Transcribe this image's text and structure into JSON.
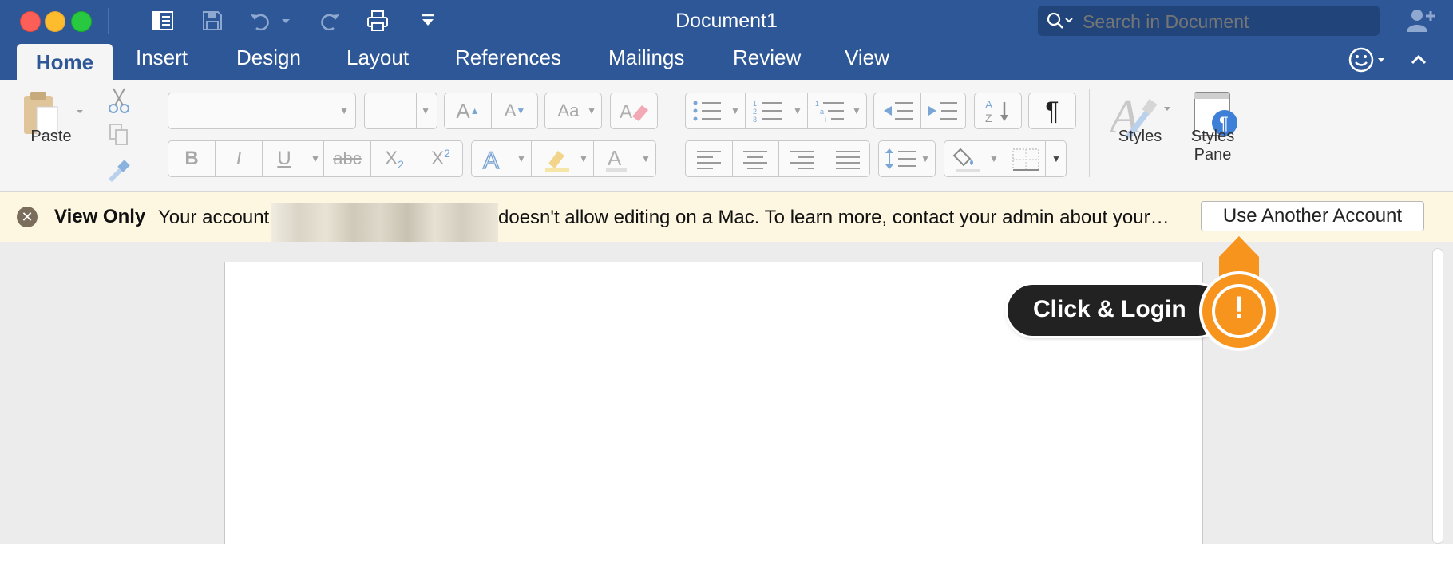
{
  "window": {
    "title": "Document1"
  },
  "search": {
    "placeholder": "Search in Document"
  },
  "tabs": [
    {
      "label": "Home",
      "active": true
    },
    {
      "label": "Insert"
    },
    {
      "label": "Design"
    },
    {
      "label": "Layout"
    },
    {
      "label": "References"
    },
    {
      "label": "Mailings"
    },
    {
      "label": "Review"
    },
    {
      "label": "View"
    }
  ],
  "ribbon": {
    "paste_label": "Paste",
    "styles_label": "Styles",
    "styles_pane_label_line1": "Styles",
    "styles_pane_label_line2": "Pane",
    "bold_glyph": "B",
    "italic_glyph": "I",
    "underline_glyph": "U",
    "strike_glyph": "abc",
    "subscript_glyph": "X",
    "subscript_small": "2",
    "superscript_glyph": "X",
    "superscript_small": "2",
    "pilcrow_glyph": "¶"
  },
  "message_bar": {
    "status": "View Only",
    "text_before": "Your account",
    "text_after": "doesn't allow editing on a Mac. To learn more, contact your admin about your…",
    "button": "Use Another Account"
  },
  "callout": {
    "text": "Click & Login",
    "mark": "!"
  },
  "colors": {
    "titlebar": "#2d5797",
    "close": "#fc5f57",
    "minimize": "#fdbc2e",
    "maximize": "#28c940",
    "accent_orange": "#f7941d",
    "message_bar_bg": "#fdf6e0"
  }
}
